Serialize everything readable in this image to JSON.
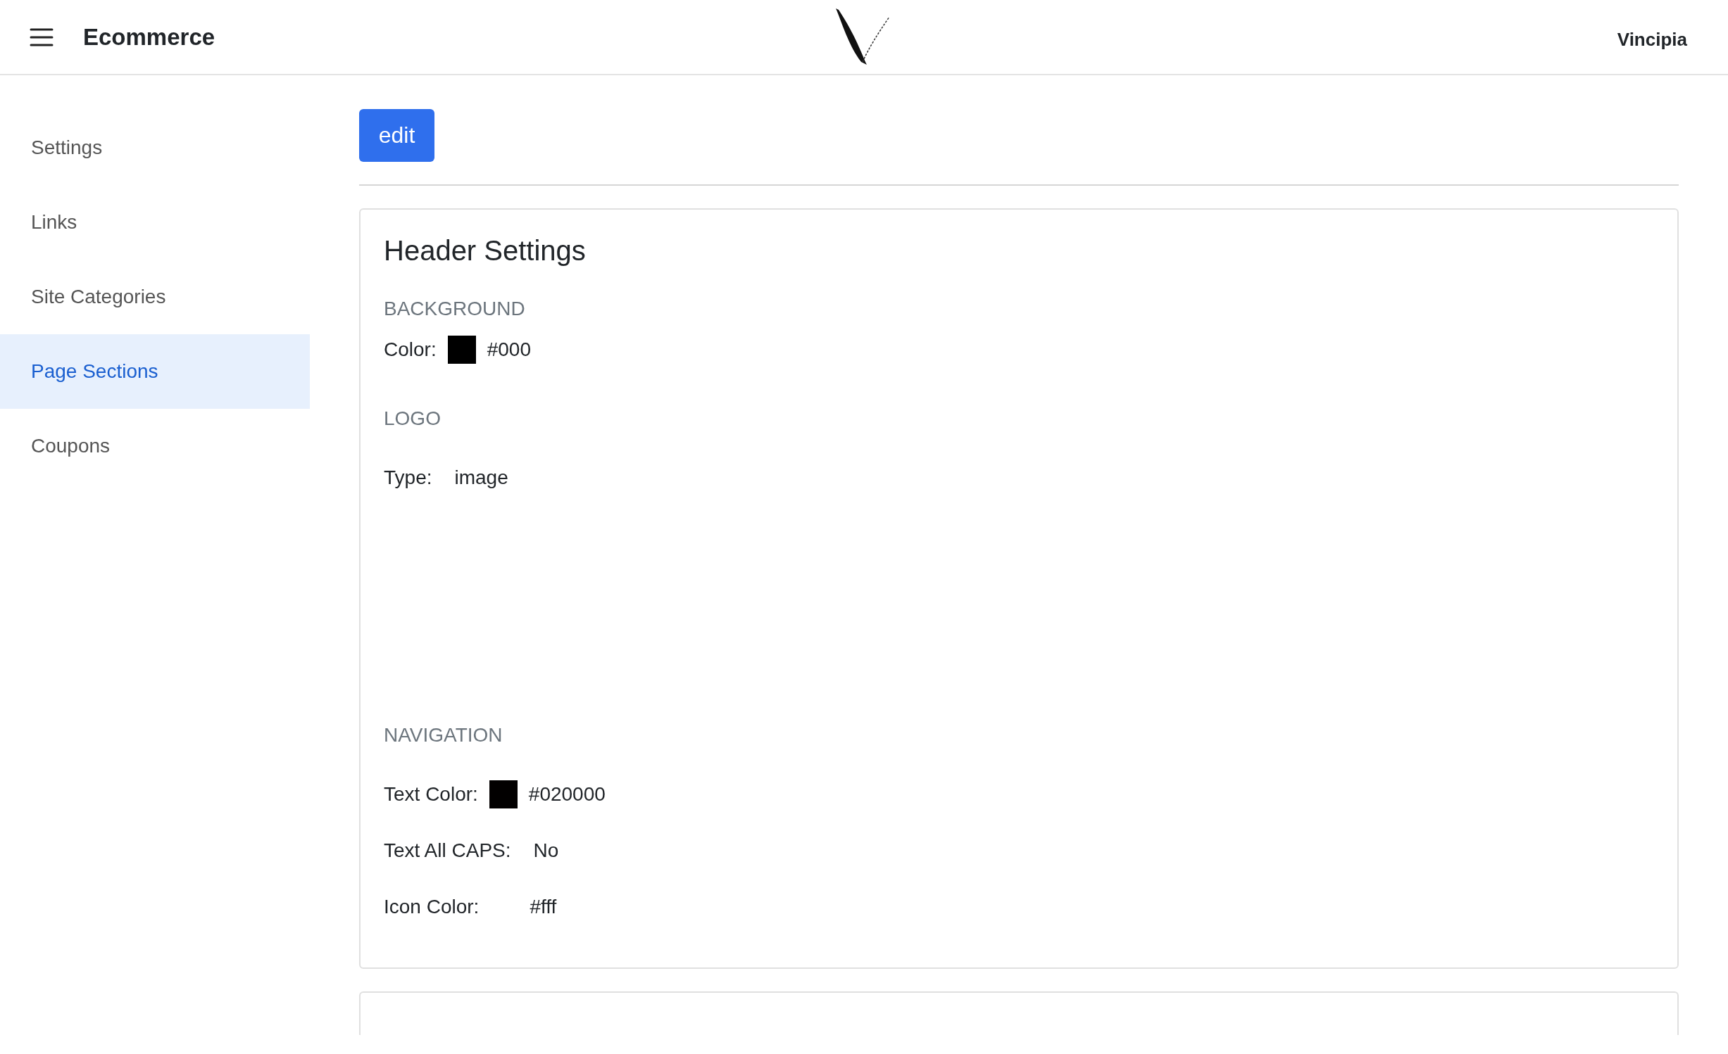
{
  "header": {
    "title": "Ecommerce",
    "user": "Vincipia"
  },
  "sidebar": {
    "items": [
      {
        "label": "Settings",
        "selected": false
      },
      {
        "label": "Links",
        "selected": false
      },
      {
        "label": "Site Categories",
        "selected": false
      },
      {
        "label": "Page Sections",
        "selected": true
      },
      {
        "label": "Coupons",
        "selected": false
      }
    ]
  },
  "edit_button": "edit",
  "card": {
    "title": "Header Settings",
    "sections": [
      {
        "title": "BACKGROUND",
        "fields": [
          {
            "kind": "swatch",
            "label": "Color:",
            "color": "#000000",
            "value": "#000"
          }
        ]
      },
      {
        "title": "LOGO",
        "fields": [
          {
            "kind": "text",
            "label": "Type:",
            "value": "image"
          }
        ]
      },
      {
        "title": "NAVIGATION",
        "fields": [
          {
            "kind": "swatch",
            "label": "Text Color:",
            "color": "#020000",
            "value": "#020000"
          },
          {
            "kind": "text",
            "label": "Text All CAPS:",
            "value": "No"
          },
          {
            "kind": "swatch",
            "label": "Icon Color:",
            "value": "#fff"
          }
        ]
      }
    ]
  }
}
